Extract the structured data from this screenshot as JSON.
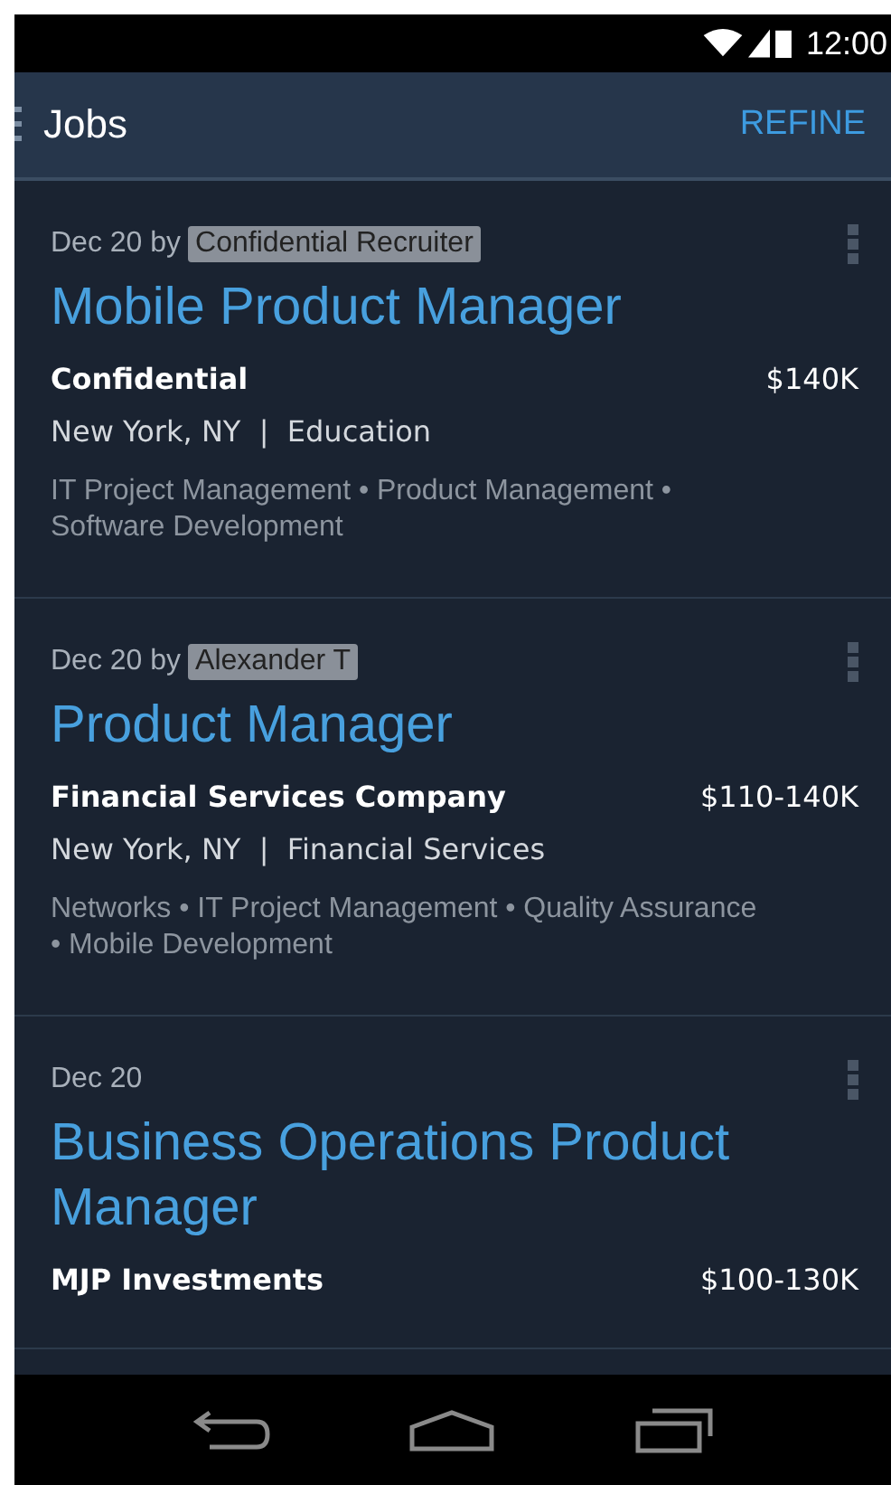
{
  "status_bar": {
    "time": "12:00"
  },
  "app_bar": {
    "title": "Jobs",
    "action": "REFINE"
  },
  "jobs": [
    {
      "posted": "Dec 20 by",
      "poster": "Confidential Recruiter",
      "title": "Mobile Product Manager",
      "company": "Confidential",
      "salary": "$140K",
      "location": "New York, NY  |  Education",
      "skills": "IT Project Management • Product Management • Software Development"
    },
    {
      "posted": "Dec 20 by",
      "poster": "Alexander T",
      "title": "Product Manager",
      "company": "Financial Services Company",
      "salary": "$110-140K",
      "location": "New York, NY  |  Financial Services",
      "skills": "Networks • IT Project Management • Quality Assurance • Mobile Development"
    },
    {
      "posted": "Dec 20",
      "title": "Business Operations Product Manager",
      "company": "MJP Investments",
      "salary": "$100-130K"
    }
  ]
}
